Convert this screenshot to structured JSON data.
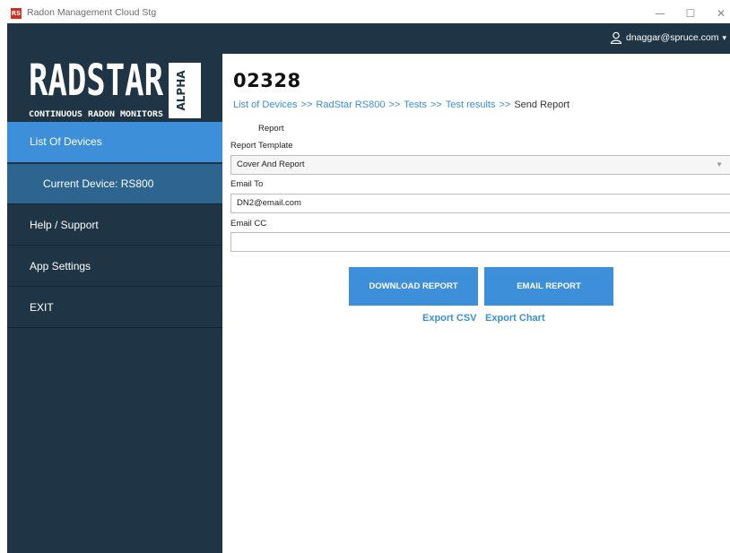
{
  "window": {
    "icon_text": "RS",
    "title": "Radon Management Cloud Stg",
    "minimize": "—",
    "maximize": "☐",
    "close": "✕"
  },
  "brand": {
    "logo_text": "RADSTAR",
    "logo_badge": "ALPHA",
    "logo_tagline": "CONTINUOUS RADON MONITORS",
    "colors": {
      "sidebar": "#1f3546",
      "accent": "#3c8fd8",
      "sub_nav": "#2d6590"
    }
  },
  "sidebar": {
    "items": [
      {
        "label": "List Of Devices",
        "state": "active"
      },
      {
        "label": "Current Device: RS800",
        "state": "sub"
      },
      {
        "label": "Help / Support"
      },
      {
        "label": "App Settings"
      },
      {
        "label": "EXIT"
      }
    ]
  },
  "header": {
    "user_icon": "user-icon",
    "user_email": "dnaggar@spruce.com",
    "chevron": "▾"
  },
  "main": {
    "device_id": "02328",
    "breadcrumb": {
      "links": [
        "List of Devices",
        "RadStar RS800",
        "Tests",
        "Test results"
      ],
      "separator": ">>",
      "current": "Send Report"
    },
    "form": {
      "section_title": "Report",
      "template_label": "Report Template",
      "template_value": "Cover And Report",
      "email_to_label": "Email To",
      "email_to_value": "DN2@email.com",
      "email_cc_label": "Email CC",
      "email_cc_value": ""
    },
    "buttons": {
      "download": "DOWNLOAD REPORT",
      "email": "EMAIL REPORT"
    },
    "links": {
      "export_csv": "Export CSV",
      "export_chart": "Export Chart"
    }
  }
}
